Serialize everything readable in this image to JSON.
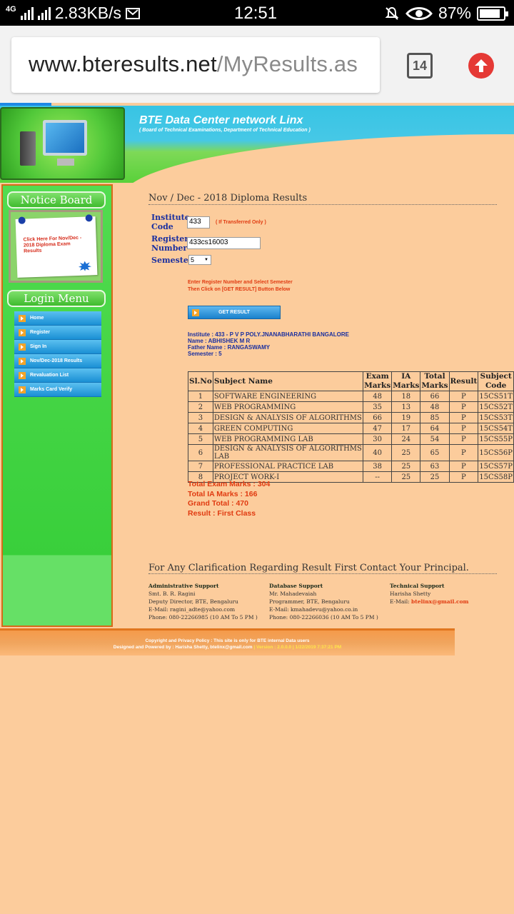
{
  "status_bar": {
    "network": "4G",
    "speed": "2.83KB/s",
    "time": "12:51",
    "battery": "87%",
    "battery_level": 0.87
  },
  "browser": {
    "url_domain": "www.bteresults.net",
    "url_path": "/MyResults.as",
    "tab_count": "14"
  },
  "banner": {
    "title": "BTE Data Center network Linx",
    "subtitle": "( Board of Technical Examinations, Department of Technical Education )"
  },
  "sidebar": {
    "notice_heading": "Notice Board",
    "notice_text": "Click Here For Nov/Dec - 2018 Diploma Exam Results",
    "login_heading": "Login Menu",
    "menu": [
      {
        "label": "Home"
      },
      {
        "label": "Register"
      },
      {
        "label": "Sign In"
      },
      {
        "label": "Nov/Dec-2018 Results"
      },
      {
        "label": "Revaluation List"
      },
      {
        "label": "Marks Card Verify"
      }
    ]
  },
  "main": {
    "title": "Nov / Dec - 2018 Diploma Results",
    "form": {
      "institute_label": "Institute Code",
      "institute_value": "433",
      "transfer_note": "( If Transferred Only )",
      "register_label": "Register Number",
      "register_value": "433cs16003",
      "semester_label": "Semester",
      "semester_value": "5"
    },
    "instructions_line1": "Enter Register Number and Select Semester",
    "instructions_line2": "Then Click on [GET RESULT] Button Below",
    "get_result": "GET RESULT",
    "student": {
      "institute": "Institute : 433 - P V P POLY.JNANABHARATHI BANGALORE",
      "name": "Name : ABHISHEK M R",
      "father": "Father Name : RANGASWAMY",
      "semester": "Semester : 5"
    },
    "table": {
      "headers": [
        "Sl.No",
        "Subject Name",
        "Exam Marks",
        "IA Marks",
        "Total Marks",
        "Result",
        "Subject Code"
      ],
      "rows": [
        [
          "1",
          "SOFTWARE ENGINEERING",
          "48",
          "18",
          "66",
          "P",
          "15CS51T"
        ],
        [
          "2",
          "WEB PROGRAMMING",
          "35",
          "13",
          "48",
          "P",
          "15CS52T"
        ],
        [
          "3",
          "DESIGN & ANALYSIS OF ALGORITHMS",
          "66",
          "19",
          "85",
          "P",
          "15CS53T"
        ],
        [
          "4",
          "GREEN COMPUTING",
          "47",
          "17",
          "64",
          "P",
          "15CS54T"
        ],
        [
          "5",
          "WEB PROGRAMMING LAB",
          "30",
          "24",
          "54",
          "P",
          "15CS55P"
        ],
        [
          "6",
          "DESIGN & ANALYSIS OF ALGORITHMS LAB",
          "40",
          "25",
          "65",
          "P",
          "15CS56P"
        ],
        [
          "7",
          "PROFESSIONAL PRACTICE LAB",
          "38",
          "25",
          "63",
          "P",
          "15CS57P"
        ],
        [
          "8",
          "PROJECT WORK-I",
          "--",
          "25",
          "25",
          "P",
          "15CS58P"
        ]
      ]
    },
    "totals": {
      "exam": "Total Exam Marks : 304",
      "ia": "Total IA Marks : 166",
      "grand": "Grand Total : 470",
      "result": "Result : First Class"
    },
    "clarification": "For Any Clarification Regarding Result First Contact Your Principal.",
    "support": {
      "admin": {
        "title": "Administrative Support",
        "name": "Smt. B. R. Ragini",
        "role": "Deputy Director, BTE, Bengaluru",
        "email": "E-Mail: ragini_adte@yahoo.com",
        "phone": "Phone: 080-22266985 (10 AM To 5 PM )"
      },
      "database": {
        "title": "Database Support",
        "name": "Mr. Mahadevaiah",
        "role": "Programmer, BTE, Bengaluru",
        "email": "E-Mail: kmahadevu@yahoo.co.in",
        "phone": "Phone: 080-22266036 (10 AM To 5 PM )"
      },
      "technical": {
        "title": "Technical Support",
        "name": "Harisha Shetty",
        "email_label": "E-Mail: ",
        "email": "btelinx@gmail.com"
      }
    }
  },
  "footer": {
    "line1": "Copyright and Privacy Policy : This site is only for BTE internal Data users",
    "line2": "Designed and Powered by : Harisha Shetty, btelinx@gmail.com",
    "version": " | Version : 2.0.0.0 | 1/22/2019 7:37:21 PM"
  },
  "colors": {
    "page_bg": "#fccc9c",
    "sidebar_green": "#39cf3b",
    "link_blue": "#1a2fa0",
    "alert_red": "#e03a10",
    "menu_blue": "#1a8fd4"
  }
}
